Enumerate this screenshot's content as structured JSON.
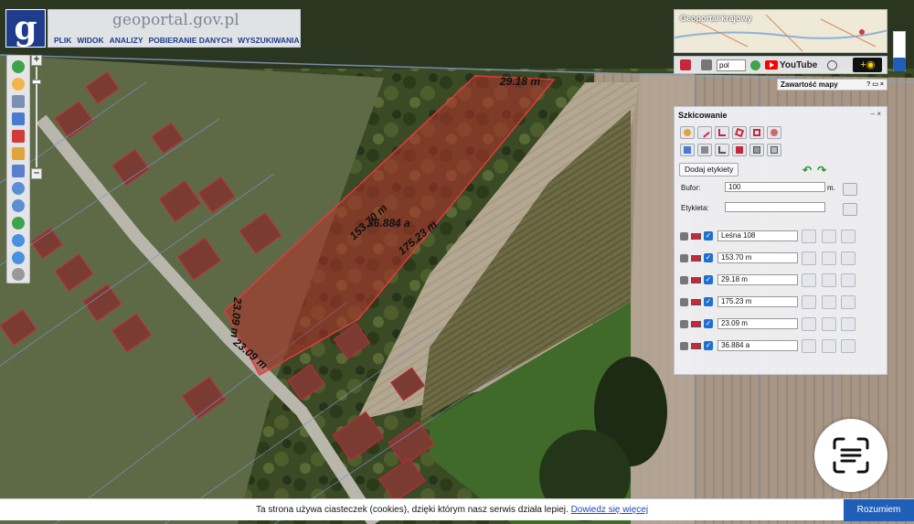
{
  "header": {
    "logo_letter": "g",
    "site_name": "geoportal.gov.pl",
    "menu": [
      "PLIK",
      "WIDOK",
      "ANALIZY",
      "POBIERANIE DANYCH",
      "WYSZUKIWANIA"
    ]
  },
  "overview": {
    "title": "Geoportal krajowy"
  },
  "tool_strip": {
    "language": "pol",
    "youtube": "YouTube"
  },
  "zawartosc": {
    "title": "Zawartość mapy",
    "controls": "? ▭ ×"
  },
  "map_labels": {
    "top_edge": "29.18 m",
    "long_edge": "153.70 m",
    "area": "36.884 a",
    "right_edge": "175.23 m",
    "left_edge": "23.09 m",
    "bottom_edge": "23.09 m"
  },
  "sketch_panel": {
    "title": "Szkicowanie",
    "controls": "– ×",
    "add_labels_button": "Dodaj etykiety",
    "buffer_label": "Bufor:",
    "buffer_value": "100",
    "buffer_unit": "m.",
    "label_label": "Etykieta:",
    "label_value": "",
    "items": [
      {
        "value": "Leśna 108"
      },
      {
        "value": "153.70 m"
      },
      {
        "value": "29.18 m"
      },
      {
        "value": "175.23 m"
      },
      {
        "value": "23.09 m"
      },
      {
        "value": "36.884 a"
      }
    ]
  },
  "cookie_bar": {
    "text": "Ta strona używa ciasteczek (cookies), dzięki którym nasz serwis działa lepiej.",
    "link": "Dowiedz się więcej",
    "button": "Rozumiem"
  },
  "colors": {
    "brand_blue": "#1f3c8c",
    "parcel_red": "#c8273a",
    "accent_blue": "#1f5fb8"
  }
}
